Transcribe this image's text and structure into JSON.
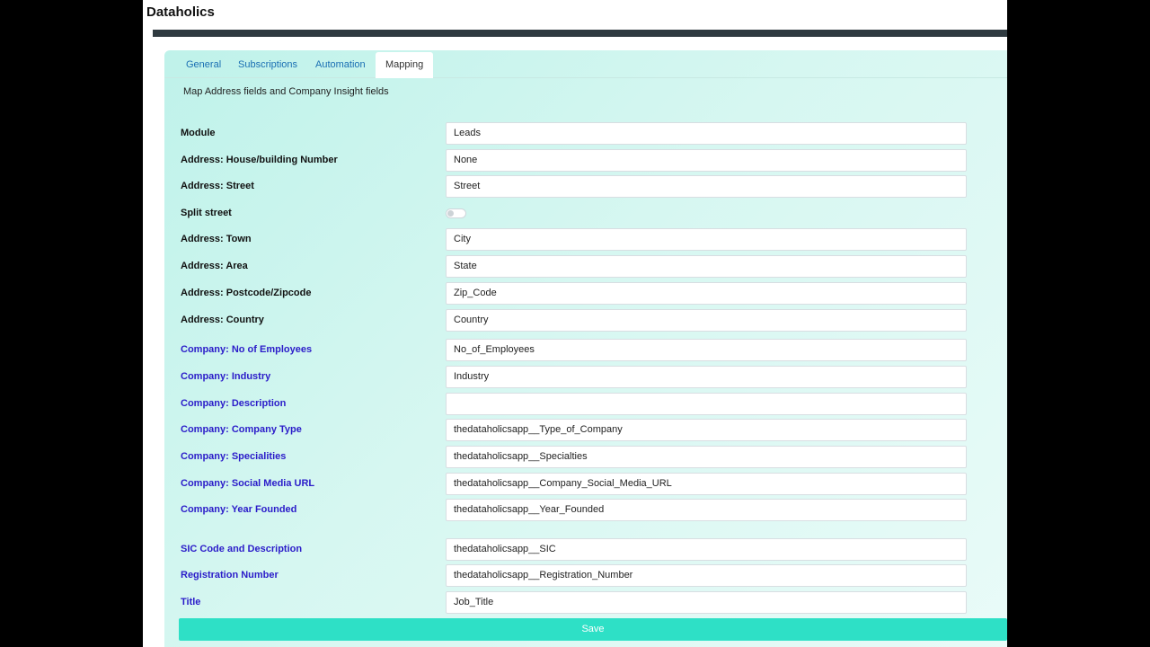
{
  "app": {
    "title": "Dataholics"
  },
  "tabs": [
    {
      "label": "General",
      "active": false
    },
    {
      "label": "Subscriptions",
      "active": false
    },
    {
      "label": "Automation",
      "active": false
    },
    {
      "label": "Mapping",
      "active": true
    }
  ],
  "mapping": {
    "description": "Map Address fields and Company Insight fields",
    "rows": [
      {
        "label": "Module",
        "value": "Leads",
        "kind": "address"
      },
      {
        "label": "Address: House/building Number",
        "value": "None",
        "kind": "address"
      },
      {
        "label": "Address: Street",
        "value": "Street",
        "kind": "address"
      },
      {
        "label": "Split street",
        "toggle": false,
        "kind": "address"
      },
      {
        "label": "Address: Town",
        "value": "City",
        "kind": "address"
      },
      {
        "label": "Address: Area",
        "value": "State",
        "kind": "address"
      },
      {
        "label": "Address: Postcode/Zipcode",
        "value": "Zip_Code",
        "kind": "address"
      },
      {
        "label": "Address: Country",
        "value": "Country",
        "kind": "address"
      },
      {
        "label": "Company: No of Employees",
        "value": "No_of_Employees",
        "kind": "company"
      },
      {
        "label": "Company: Industry",
        "value": "Industry",
        "kind": "company"
      },
      {
        "label": "Company: Description",
        "value": "",
        "kind": "company"
      },
      {
        "label": "Company: Company Type",
        "value": "thedataholicsapp__Type_of_Company",
        "kind": "company"
      },
      {
        "label": "Company: Specialities",
        "value": "thedataholicsapp__Specialties",
        "kind": "company"
      },
      {
        "label": "Company: Social Media URL",
        "value": "thedataholicsapp__Company_Social_Media_URL",
        "kind": "company"
      },
      {
        "label": "Company: Year Founded",
        "value": "thedataholicsapp__Year_Founded",
        "kind": "company"
      },
      {
        "label": "SIC Code and Description",
        "value": "thedataholicsapp__SIC",
        "kind": "company"
      },
      {
        "label": "Registration Number",
        "value": "thedataholicsapp__Registration_Number",
        "kind": "company"
      },
      {
        "label": "Title",
        "value": "Job_Title",
        "kind": "company"
      }
    ],
    "save_label": "Save"
  },
  "colors": {
    "accent_teal": "#2ee0c6",
    "company_label": "#2b1cc9",
    "tab_link": "#1a6fb3"
  }
}
